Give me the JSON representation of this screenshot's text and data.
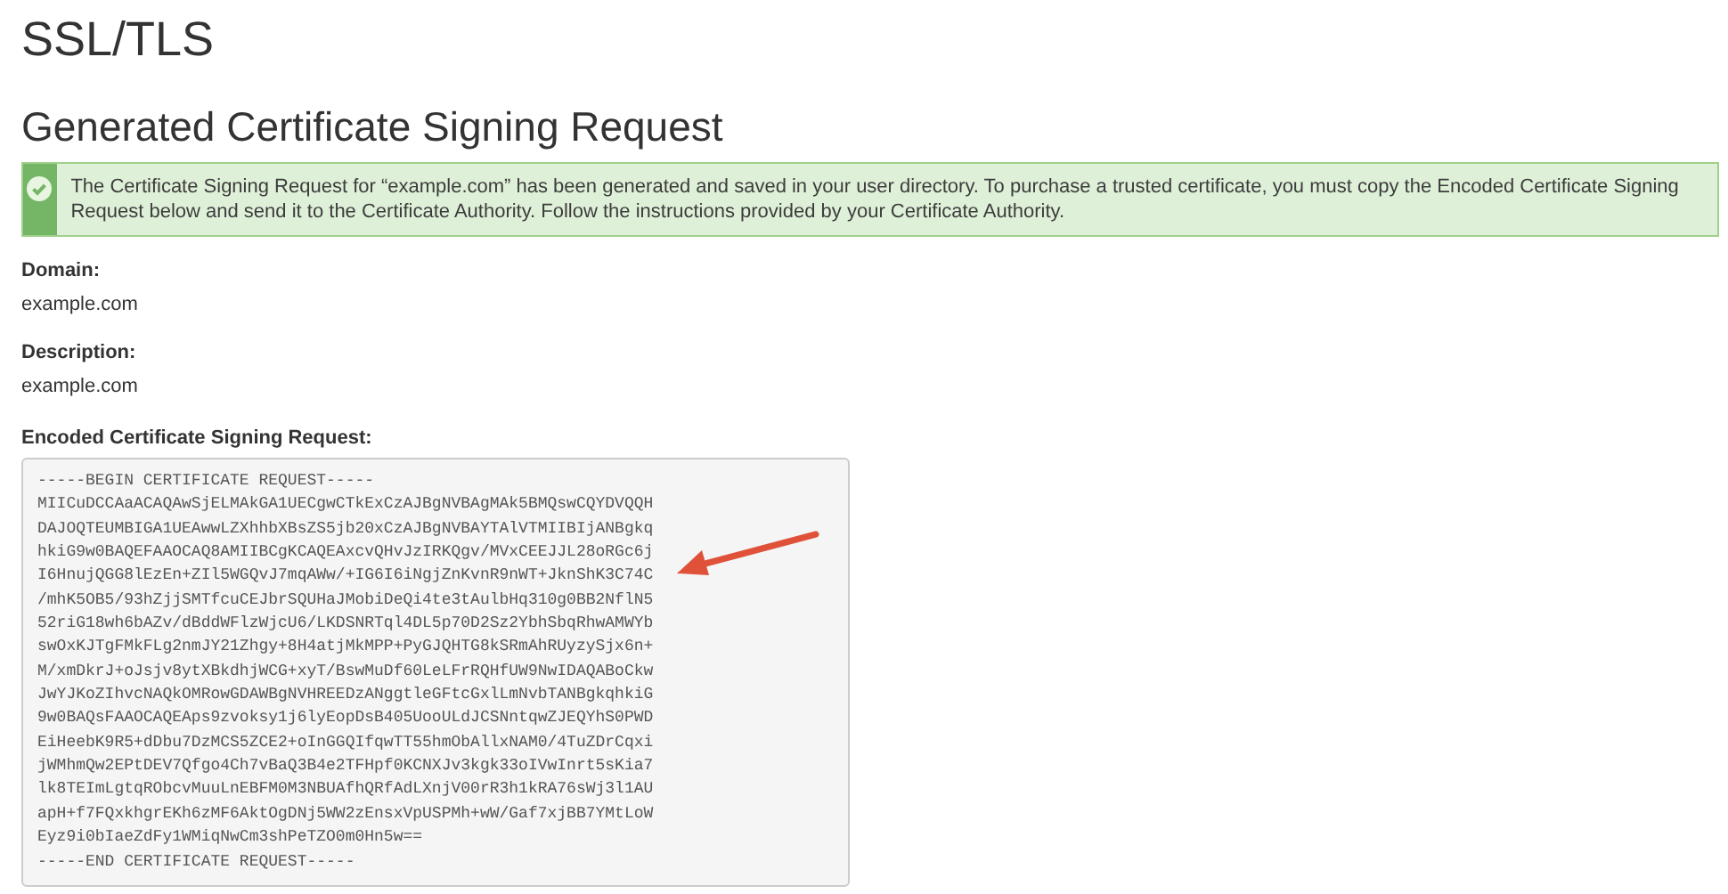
{
  "page_title": "SSL/TLS",
  "heading": "Generated Certificate Signing Request",
  "alert": {
    "kind": "success",
    "text": "The Certificate Signing Request for “example.com” has been generated and saved in your user directory. To purchase a trusted certificate, you must copy the Encoded Certificate Signing Request below and send it to the Certificate Authority. Follow the instructions provided by your Certificate Authority."
  },
  "fields": [
    {
      "label": "Domain:",
      "value": "example.com"
    },
    {
      "label": "Description:",
      "value": "example.com"
    }
  ],
  "csr": {
    "label": "Encoded Certificate Signing Request:",
    "lines": [
      "-----BEGIN CERTIFICATE REQUEST-----",
      "MIICuDCCAaACAQAwSjELMAkGA1UECgwCTkExCzAJBgNVBAgMAk5BMQswCQYDVQQH",
      "DAJOQTEUMBIGA1UEAwwLZXhhbXBsZS5jb20xCzAJBgNVBAYTAlVTMIIBIjANBgkq",
      "hkiG9w0BAQEFAAOCAQ8AMIIBCgKCAQEAxcvQHvJzIRKQgv/MVxCEEJJL28oRGc6j",
      "I6HnujQGG8lEzEn+ZIl5WGQvJ7mqAWw/+IG6I6iNgjZnKvnR9nWT+JknShK3C74C",
      "/mhK5OB5/93hZjjSMTfcuCEJbrSQUHaJMobiDeQi4te3tAulbHq310g0BB2NflN5",
      "52riG18wh6bAZv/dBddWFlzWjcU6/LKDSNRTql4DL5p70D2Sz2YbhSbqRhwAMWYb",
      "swOxKJTgFMkFLg2nmJY21Zhgy+8H4atjMkMPP+PyGJQHTG8kSRmAhRUyzySjx6n+",
      "M/xmDkrJ+oJsjv8ytXBkdhjWCG+xyT/BswMuDf60LeLFrRQHfUW9NwIDAQABoCkw",
      "JwYJKoZIhvcNAQkOMRowGDAWBgNVHREEDzANggtleGFtcGxlLmNvbTANBgkqhkiG",
      "9w0BAQsFAAOCAQEAps9zvoksy1j6lyEopDsB405UooULdJCSNntqwZJEQYhS0PWD",
      "EiHeebK9R5+dDbu7DzMCS5ZCE2+oInGGQIfqwTT55hmObAllxNAM0/4TuZDrCqxi",
      "jWMhmQw2EPtDEV7Qfgo4Ch7vBaQ3B4e2TFHpf0KCNXJv3kgk33oIVwInrt5sKia7",
      "lk8TEImLgtqRObcvMuuLnEBFM0M3NBUAfhQRfAdLXnjV00rR3h1kRA76sWj3l1AU",
      "apH+f7FQxkhgrEKh6zMF6AktOgDNj5WW2zEnsxVpUSPMh+wW/Gaf7xjBB7YMtLoW",
      "Eyz9i0bIaeZdFy1WMiqNwCm3shPeTZO0m0Hn5w==",
      "-----END CERTIFICATE REQUEST-----"
    ]
  },
  "annotation": {
    "kind": "arrow"
  }
}
